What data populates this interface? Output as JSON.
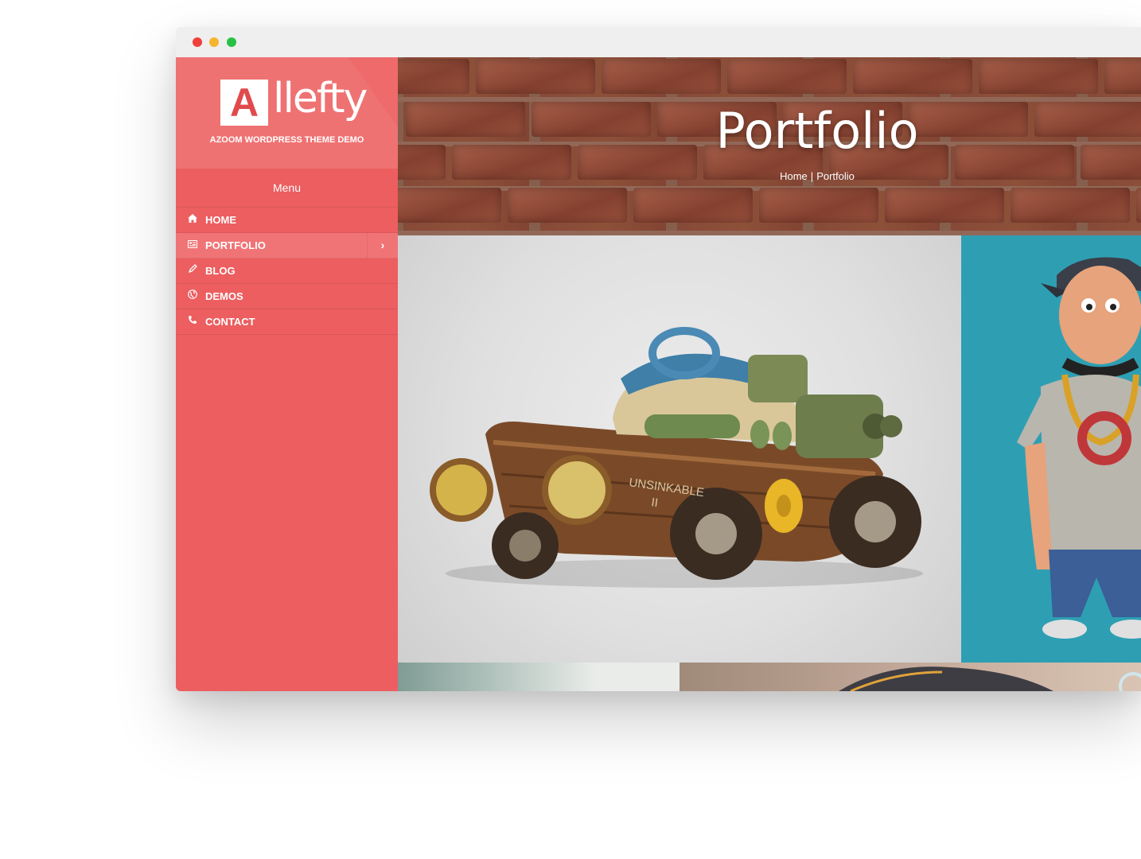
{
  "brand": {
    "logo_letter": "A",
    "logo_rest": "llefty",
    "tagline": "AZOOM WORDPRESS THEME DEMO",
    "accent_color": "#ec5e60"
  },
  "sidebar": {
    "menu_title": "Menu",
    "items": [
      {
        "label": "HOME",
        "icon": "home-icon",
        "active": false
      },
      {
        "label": "PORTFOLIO",
        "icon": "portfolio-icon",
        "active": true
      },
      {
        "label": "BLOG",
        "icon": "pencil-icon",
        "active": false
      },
      {
        "label": "DEMOS",
        "icon": "globe-icon",
        "active": false
      },
      {
        "label": "CONTACT",
        "icon": "phone-icon",
        "active": false
      }
    ]
  },
  "hero": {
    "title": "Portfolio",
    "breadcrumb": {
      "home": "Home",
      "separator": "|",
      "current": "Portfolio"
    }
  },
  "portfolio": {
    "tiles": [
      {
        "name": "steampunk-boat-car"
      },
      {
        "name": "cartoon-boy-figure"
      }
    ]
  }
}
